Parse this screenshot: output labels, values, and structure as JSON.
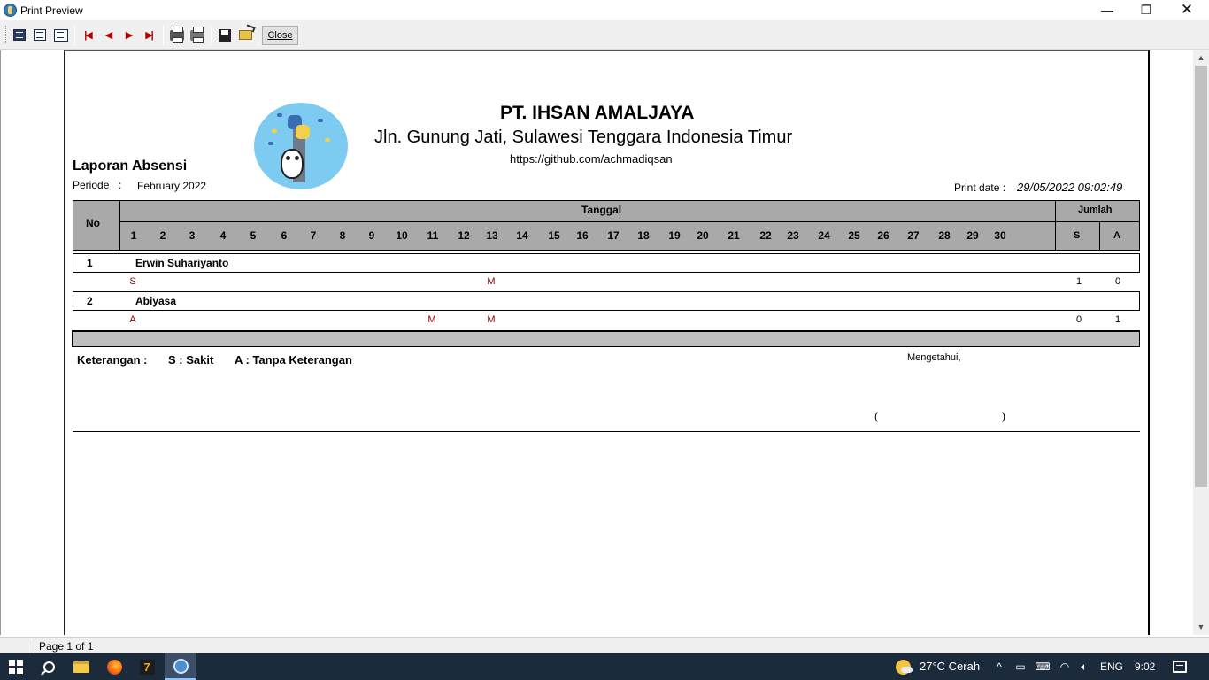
{
  "window": {
    "title": "Print Preview",
    "minimize_glyph": "—",
    "maximize_glyph": "❐",
    "close_glyph": "✕"
  },
  "toolbar": {
    "close_label": "Close",
    "icons": [
      "page-width-icon",
      "whole-page-icon",
      "zoom-icon",
      "first-page-icon",
      "previous-page-icon",
      "next-page-icon",
      "last-page-icon",
      "print-setup-icon",
      "print-icon",
      "save-icon",
      "open-icon"
    ]
  },
  "report": {
    "company": "PT. IHSAN AMALJAYA",
    "address": "Jln. Gunung Jati, Sulawesi Tenggara Indonesia Timur",
    "url": "https://github.com/achmadiqsan",
    "title": "Laporan Absensi",
    "periode_label": "Periode",
    "periode_colon": ":",
    "periode_value": "February 2022",
    "print_date_label": "Print date :",
    "print_date_value": "29/05/2022 09:02:49",
    "header": {
      "no": "No",
      "tanggal": "Tanggal",
      "jumlah": "Jumlah",
      "s": "S",
      "a": "A",
      "days": [
        "1",
        "2",
        "3",
        "4",
        "5",
        "6",
        "7",
        "8",
        "9",
        "10",
        "11",
        "12",
        "13",
        "14",
        "15",
        "16",
        "17",
        "18",
        "19",
        "20",
        "21",
        "22",
        "23",
        "24",
        "25",
        "26",
        "27",
        "28",
        "29",
        "30"
      ]
    },
    "employees": [
      {
        "no": "1",
        "name": "Erwin Suhariyanto",
        "marks": [
          {
            "day": 1,
            "code": "S"
          },
          {
            "day": 13,
            "code": "M"
          }
        ],
        "sum_s": "1",
        "sum_a": "0"
      },
      {
        "no": "2",
        "name": "Abiyasa",
        "marks": [
          {
            "day": 1,
            "code": "A"
          },
          {
            "day": 11,
            "code": "M"
          },
          {
            "day": 13,
            "code": "M"
          }
        ],
        "sum_s": "0",
        "sum_a": "1"
      }
    ],
    "keterangan_label": "Keterangan :",
    "keterangan_s": "S : Sakit",
    "keterangan_a": "A : Tanpa Keterangan",
    "mengetahui": "Mengetahui,",
    "paren_open": "(",
    "paren_close": ")"
  },
  "statusbar": {
    "page": "Page 1 of 1"
  },
  "taskbar": {
    "weather": "27°C  Cerah",
    "language": "ENG",
    "time": "9:02",
    "chevron": "^"
  }
}
